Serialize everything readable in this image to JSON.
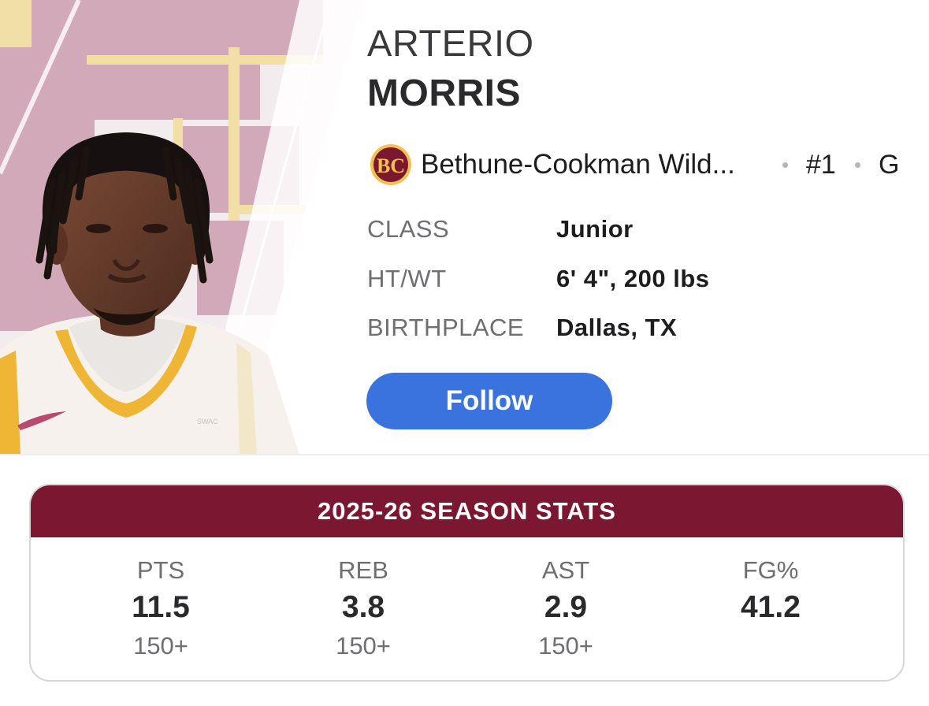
{
  "player": {
    "first_name": "ARTERIO",
    "last_name": "MORRIS",
    "team": "Bethune-Cookman Wild...",
    "team_logo_text": "BC",
    "jersey": "#1",
    "position": "G",
    "attributes": [
      {
        "label": "CLASS",
        "value": "Junior"
      },
      {
        "label": "HT/WT",
        "value": "6' 4\", 200 lbs"
      },
      {
        "label": "BIRTHPLACE",
        "value": "Dallas, TX"
      }
    ],
    "photo_jersey_text": "SWAC"
  },
  "follow_label": "Follow",
  "stats": {
    "title": "2025-26 SEASON STATS",
    "items": [
      {
        "label": "PTS",
        "value": "11.5",
        "rank": "150+"
      },
      {
        "label": "REB",
        "value": "3.8",
        "rank": "150+"
      },
      {
        "label": "AST",
        "value": "2.9",
        "rank": "150+"
      },
      {
        "label": "FG%",
        "value": "41.2",
        "rank": ""
      }
    ]
  },
  "colors": {
    "accent": "#3a73de",
    "team_maroon": "#7b1730",
    "team_gold": "#f2c14e",
    "backdrop_pink": "#d2a9b9",
    "backdrop_gold": "#f2dfa6"
  }
}
